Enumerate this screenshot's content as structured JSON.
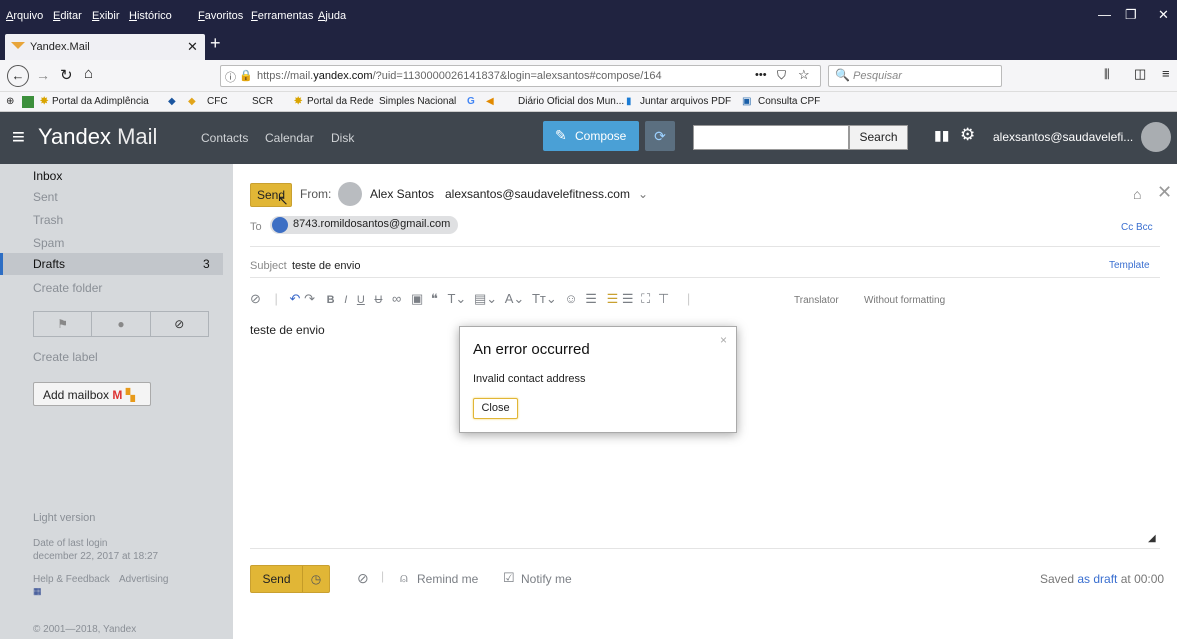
{
  "menubar": {
    "items": [
      "Arquivo",
      "Editar",
      "Exibir",
      "Histórico",
      "Favoritos",
      "Ferramentas",
      "Ajuda"
    ]
  },
  "tab": {
    "title": "Yandex.Mail"
  },
  "urlbar": {
    "url_prefix": "https://mail.",
    "url_domain": "yandex.com",
    "url_rest": "/?uid=1130000026141837&login=alexsantos#compose/164",
    "search_placeholder": "Pesquisar"
  },
  "bookmarks": [
    "Portal da Adimplência",
    "CFC",
    "SCR",
    "Portal da Rede",
    "Simples Nacional",
    "Diário Oficial dos Mun...",
    "Juntar arquivos PDF",
    "Consulta CPF"
  ],
  "header": {
    "logo_strong": "Yandex",
    "logo_light": " Mail",
    "nav": [
      "Contacts",
      "Calendar",
      "Disk"
    ],
    "compose": "Compose",
    "search_btn": "Search",
    "account": "alexsantos@saudavelefi..."
  },
  "sidebar": {
    "folders": [
      {
        "label": "Inbox",
        "count": ""
      },
      {
        "label": "Sent",
        "count": ""
      },
      {
        "label": "Trash",
        "count": ""
      },
      {
        "label": "Spam",
        "count": ""
      },
      {
        "label": "Drafts",
        "count": "3"
      }
    ],
    "create_folder": "Create folder",
    "create_label": "Create label",
    "add_mailbox": "Add mailbox",
    "light_version": "Light version",
    "last_login_label": "Date of last login",
    "last_login_date": "december 22, 2017 at 18:27",
    "help": "Help & Feedback",
    "advertising": "Advertising",
    "copyright": "© 2001—2018, Yandex"
  },
  "compose": {
    "send": "Send",
    "from_label": "From:",
    "from_name": "Alex Santos",
    "from_email": "alexsantos@saudavelefitness.com",
    "to_label": "To",
    "to_address": "8743.romildosantos@gmail.com",
    "cc_bcc": "Cc Bcc",
    "subject_label": "Subject",
    "subject": "teste de envio",
    "template": "Template",
    "translator": "Translator",
    "without_formatting": "Without formatting",
    "body": "teste de envio",
    "remind_me": "Remind me",
    "notify_me": "Notify me",
    "saved_prefix": "Saved ",
    "saved_link": "as draft",
    "saved_suffix": " at 00:00"
  },
  "dialog": {
    "title": "An error occurred",
    "message": "Invalid contact address",
    "close": "Close"
  }
}
